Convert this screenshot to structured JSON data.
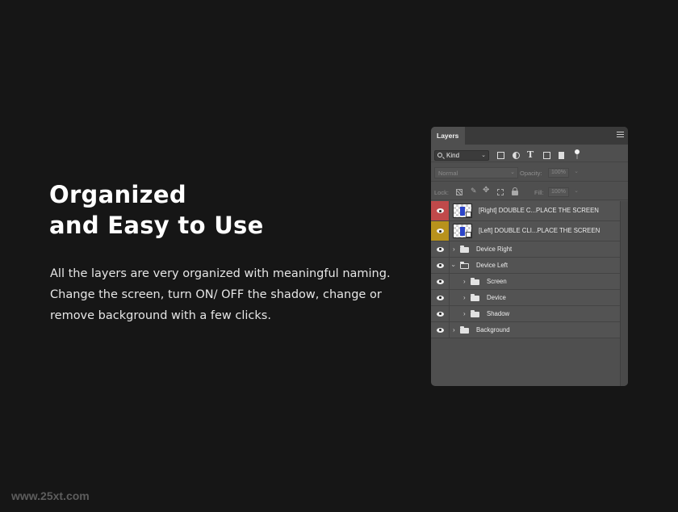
{
  "headline": {
    "line1": "Organized",
    "line2": "and Easy to Use"
  },
  "description": {
    "line1": "All the layers are very organized with meaningful naming.",
    "line2": "Change the screen, turn ON/ OFF the shadow, change or",
    "line3": "remove background with a few clicks."
  },
  "watermark": "www.25xt.com",
  "layers_panel": {
    "tab": "Layers",
    "filter": {
      "kind_label": "Kind"
    },
    "blend": {
      "mode": "Normal",
      "opacity_label": "Opacity:",
      "opacity_value": "100%",
      "fill_label": "Fill:",
      "fill_value": "100%"
    },
    "lock_label": "Lock:",
    "layers": [
      {
        "name": "[Right] DOUBLE C...PLACE THE SCREEN",
        "color": "#c0494a",
        "type": "smart-object"
      },
      {
        "name": "[Left] DOUBLE CLI...PLACE THE SCREEN",
        "color": "#b8921c",
        "type": "smart-object"
      },
      {
        "name": "Device Right",
        "type": "group",
        "expanded": false,
        "indent": 0
      },
      {
        "name": "Device Left",
        "type": "group",
        "expanded": true,
        "indent": 0
      },
      {
        "name": "Screen",
        "type": "group",
        "expanded": false,
        "indent": 1
      },
      {
        "name": "Device",
        "type": "group",
        "expanded": false,
        "indent": 1
      },
      {
        "name": "Shadow",
        "type": "group",
        "expanded": false,
        "indent": 1
      },
      {
        "name": "Background",
        "type": "group",
        "expanded": false,
        "indent": 0
      }
    ]
  }
}
